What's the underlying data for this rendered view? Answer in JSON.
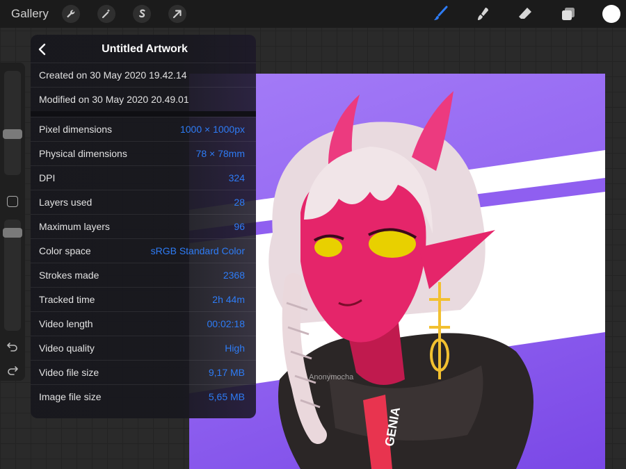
{
  "toolbar": {
    "gallery_label": "Gallery",
    "left_tools": [
      "wrench-icon",
      "magic-wand-icon",
      "selection-icon",
      "transform-arrow-icon"
    ],
    "right_tools": [
      "brush-icon",
      "smudge-icon",
      "eraser-icon",
      "layers-icon"
    ],
    "accent_color": "#2e7cf6",
    "current_color": "#ffffff"
  },
  "sidebar": {
    "brush_size_level": 0.82,
    "opacity_level": 0.9,
    "icons": [
      "undo-icon",
      "redo-icon"
    ]
  },
  "panel": {
    "title": "Untitled Artwork",
    "created": "Created on 30 May 2020 19.42.14",
    "modified": "Modified on 30 May 2020 20.49.01",
    "rows": [
      {
        "label": "Pixel dimensions",
        "value": "1000 × 1000px"
      },
      {
        "label": "Physical dimensions",
        "value": "78 × 78mm"
      },
      {
        "label": "DPI",
        "value": "324"
      },
      {
        "label": "Layers used",
        "value": "28"
      },
      {
        "label": "Maximum layers",
        "value": "96"
      },
      {
        "label": "Color space",
        "value": "sRGB Standard Color"
      },
      {
        "label": "Strokes made",
        "value": "2368"
      },
      {
        "label": "Tracked time",
        "value": "2h 44m"
      },
      {
        "label": "Video length",
        "value": "00:02:18"
      },
      {
        "label": "Video quality",
        "value": "High"
      },
      {
        "label": "Video file size",
        "value": "9,17 MB"
      },
      {
        "label": "Image file size",
        "value": "5,65 MB"
      }
    ]
  },
  "artwork": {
    "watermark": "Anonymocha",
    "hoodie_text": "GENIA",
    "background_color": "#9062f0"
  }
}
